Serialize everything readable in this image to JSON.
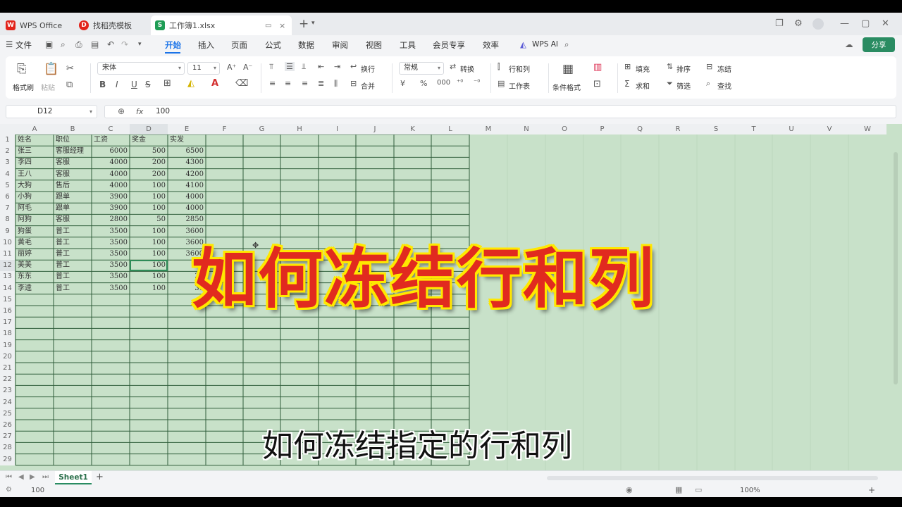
{
  "colors": {
    "accent": "#1a73e8",
    "sheet_bg": "#c8e1c9",
    "share_button": "#2a8c62",
    "title_red": "#e12a1f",
    "title_outline": "#ffe800"
  },
  "tabs": [
    {
      "label": "WPS Office",
      "icon": "wps-logo-icon"
    },
    {
      "label": "找稻壳模板",
      "icon": "docer-icon"
    },
    {
      "label": "工作簿1.xlsx",
      "icon": "spreadsheet-icon"
    }
  ],
  "menu": {
    "file_label": "文件",
    "items": [
      "开始",
      "插入",
      "页面",
      "公式",
      "数据",
      "审阅",
      "视图",
      "工具",
      "会员专享",
      "效率"
    ],
    "active": "开始",
    "wps_ai": "WPS AI",
    "share": "分享"
  },
  "ribbon": {
    "format_painter": "格式刷",
    "paste": "粘贴",
    "font_name": "宋体",
    "font_size": "11",
    "wrap": "换行",
    "merge": "合并",
    "number_format": "常规",
    "convert": "转换",
    "row_col": "行和列",
    "worksheet": "工作表",
    "conditional_format": "条件格式",
    "fill": "填充",
    "sort": "排序",
    "freeze": "冻结",
    "sum": "求和",
    "filter": "筛选",
    "find": "查找"
  },
  "formula_bar": {
    "cell_ref": "D12",
    "fx": "fx",
    "value": "100"
  },
  "columns": [
    "A",
    "B",
    "C",
    "D",
    "E",
    "F",
    "G",
    "H",
    "I",
    "J",
    "K",
    "L",
    "M",
    "N",
    "O",
    "P",
    "Q",
    "R",
    "S",
    "T",
    "U",
    "V",
    "W"
  ],
  "rows": [
    "1",
    "2",
    "3",
    "4",
    "5",
    "6",
    "7",
    "8",
    "9",
    "10",
    "11",
    "12",
    "13",
    "14",
    "15",
    "16",
    "17",
    "18",
    "19",
    "20",
    "21",
    "22",
    "23",
    "24",
    "25",
    "26",
    "27",
    "28",
    "29"
  ],
  "table": {
    "headers": [
      "姓名",
      "职位",
      "工资",
      "奖金",
      "实发"
    ],
    "rows": [
      [
        "张三",
        "客服经理",
        "6000",
        "500",
        "6500"
      ],
      [
        "李四",
        "客服",
        "4000",
        "200",
        "4300"
      ],
      [
        "王八",
        "客服",
        "4000",
        "200",
        "4200"
      ],
      [
        "大狗",
        "售后",
        "4000",
        "100",
        "4100"
      ],
      [
        "小狗",
        "跟单",
        "3900",
        "100",
        "4000"
      ],
      [
        "阿毛",
        "跟单",
        "3900",
        "100",
        "4000"
      ],
      [
        "阿狗",
        "客服",
        "2800",
        "50",
        "2850"
      ],
      [
        "狗蛋",
        "普工",
        "3500",
        "100",
        "3600"
      ],
      [
        "黄毛",
        "普工",
        "3500",
        "100",
        "3600"
      ],
      [
        "丽婷",
        "普工",
        "3500",
        "100",
        "3600"
      ],
      [
        "美美",
        "普工",
        "3500",
        "100",
        "3"
      ],
      [
        "东东",
        "普工",
        "3500",
        "100",
        "36"
      ],
      [
        "李逵",
        "普工",
        "3500",
        "100",
        "36"
      ]
    ]
  },
  "sheet_tabs": {
    "active": "Sheet1",
    "add": "+"
  },
  "status": {
    "count": "100",
    "zoom": "100%"
  },
  "overlay": {
    "title": "如何冻结行和列",
    "subtitle": "如何冻结指定的行和列"
  }
}
